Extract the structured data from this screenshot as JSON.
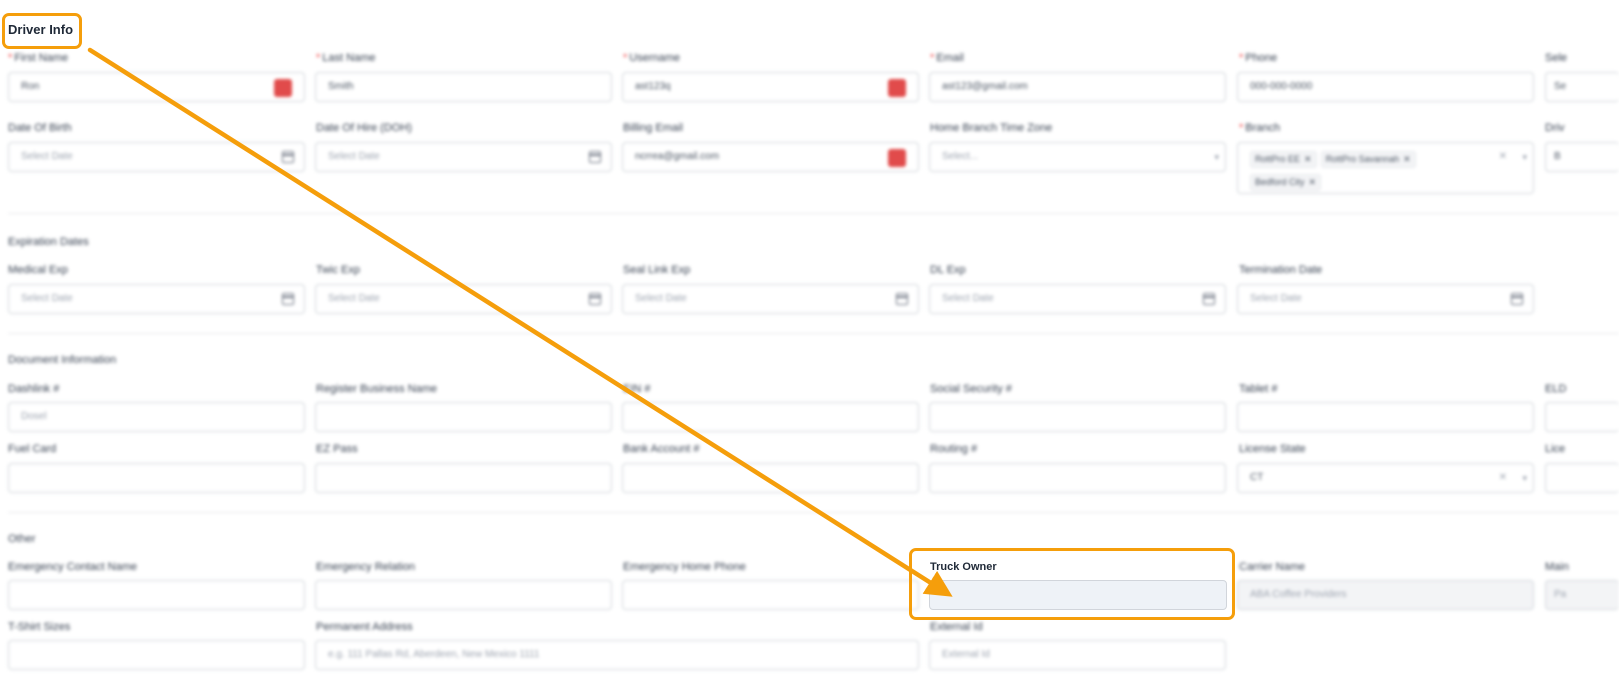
{
  "section_title": "Driver Info",
  "highlighted_field": {
    "label": "Truck Owner",
    "value": ""
  },
  "labels": {
    "first_name": "First Name",
    "last_name": "Last Name",
    "username": "Username",
    "email": "Email",
    "phone": "Phone",
    "select_col6": "Sele",
    "date_of_birth": "Date Of Birth",
    "date_of_hire": "Date Of Hire (DOH)",
    "billing_email": "Billing Email",
    "home_branch_tz": "Home Branch Time Zone",
    "branch": "Branch",
    "driver_col6": "Driv",
    "expiration_dates": "Expiration Dates",
    "medical_exp": "Medical Exp",
    "twic_exp": "Twic Exp",
    "seal_link_exp": "Seal Link Exp",
    "dl_exp": "DL Exp",
    "termination_date": "Termination Date",
    "document_information": "Document Information",
    "dashlink": "Dashlink #",
    "register_business_name": "Register Business Name",
    "ein": "EIN #",
    "ssn": "Social Security #",
    "tablet": "Tablet #",
    "eld": "ELD",
    "fuel_card": "Fuel Card",
    "ez_pass": "EZ Pass",
    "bank_account": "Bank Account #",
    "routing": "Routing #",
    "license_state": "License State",
    "license_col6": "Lice",
    "other": "Other",
    "emergency_contact_name": "Emergency Contact Name",
    "emergency_relation": "Emergency Relation",
    "emergency_home_phone": "Emergency Home Phone",
    "carrier_name": "Carrier Name",
    "main_col6": "Main",
    "tshirt_sizes": "T-Shirt Sizes",
    "permanent_address": "Permanent Address",
    "external_id": "External Id"
  },
  "values": {
    "first_name": "Ron",
    "last_name": "Smith",
    "username": "ast123q",
    "email": "ast123@gmail.com",
    "phone": "000-000-0000",
    "select_col6": "Se",
    "billing_email": "ncrrea@gmail.com",
    "driver_col6": "B",
    "license_state": "CT",
    "carrier_name": "ABA Coffee Providers",
    "main_col6": "Pa"
  },
  "placeholders": {
    "select_date": "Select Date",
    "select": "Select...",
    "dashlink": "Dosel",
    "permanent_address": "e.g. 111 Pallas Rd, Aberdeen, New Mexico 1111",
    "external_id": "External Id"
  },
  "branch_chips": [
    "RottPro EE",
    "RottPro Savannah",
    "Bedford City"
  ],
  "colors": {
    "highlight": "#f59e0b",
    "required": "#ef4444",
    "error_icon": "#e14b4b"
  }
}
